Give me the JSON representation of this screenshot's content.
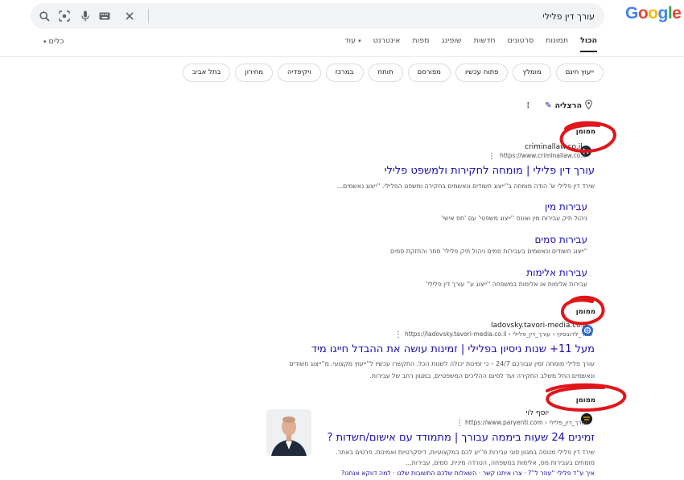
{
  "header": {
    "logo": "Google",
    "logo_colors": [
      "#4285f4",
      "#ea4335",
      "#fbbc05",
      "#4285f4",
      "#34a853",
      "#ea4335"
    ],
    "search_value": "עורך דין פלילי",
    "icons": [
      "close-icon",
      "keyboard-icon",
      "mic-icon",
      "lens-icon",
      "search-icon"
    ]
  },
  "tabs": {
    "items": [
      "הכול",
      "תמונות",
      "סרטונים",
      "חדשות",
      "שופינג",
      "מפות",
      "אינטרנט",
      "עוד"
    ],
    "active": "הכול",
    "tools_label": "כלים"
  },
  "chips": [
    "ייעוץ חינם",
    "מומלץ",
    "פתוח עכשיו",
    "מפורסם",
    "תותח",
    "במרכז",
    "ויקיפדיה",
    "מחירון",
    "בתל אביב"
  ],
  "location": {
    "label": "הרצליה"
  },
  "results": [
    {
      "sponsored": "ממומן",
      "site_name": "criminallaw.co.il",
      "url": "https://www.criminallaw.co.il",
      "title": "עורך דין פלילי | מומחה לחקירות ולמשפט פלילי",
      "description": "שירד דין פלילי ש' הודה מומחה ב''ייצוג חשודים ונאשמים בחקירה ומשפט הפלילי. ''ייצוג נאשמים...",
      "sitelinks": [
        {
          "title": "עבירות מין",
          "desc": "ניהול תיק עבירות מין ואונס ''ייצוג משפטי' עם 'חס אישי'"
        },
        {
          "title": "עבירות סמים",
          "desc": "''ייצוג חשודים ונאשמים בעבירות סמים ניהול תיק פלילי' סחר והחזקת סמים"
        },
        {
          "title": "עבירות אלימות",
          "desc": "עבירות אלימות או אלימות במשפחה ''ייצוג ע'' עורך דין פלילי'"
        }
      ]
    },
    {
      "sponsored": "ממומן",
      "site_name": "ladovsky.tavori-media.co.il",
      "url": "https://ladovsky.tavori-media.co.il › שחר_לדובסקי › עורך_דין_פלילי",
      "title": "מעל 11+ שנות ניסיון בפלילי | זמינות עושה את ההבדל חייגו מיד",
      "description_1": "עורך פלילי מומחה זמין עבורכם 24/7 – כי זמינות יכולה לשנות הכל. התקשרו עכשיו ל''ייעוץ מקצועי. מ''ייצוג חשודים",
      "description_2": "ונאשמים החל משלב החקירה ועד לסיום ההליכים המשפטיים, במגוון רחב של עבירות."
    },
    {
      "sponsored": "ממומן",
      "site_name": "יוסף לוי",
      "url": "https://www.paryenti.com › עורך_דין_פלילי",
      "title": "זמינים 24 שעות ביממה עבורך | מתמודד עם אישום/חשדות ?",
      "description_1": "שירד דין פלילי מנוסה במגוון סוגי עבירות ס''יע לכם במקצועיות, דיסקרטיות ואמינות. פרטים באתר.",
      "description_2": "מומחים בעבירות מס, אלימות במשפחה, הטרדה מינית, סמים, עבירות...",
      "inline_links": [
        "איך ע''ד פלילי ''עוזר ל''?",
        "צרו איתנו קשר",
        "השאלות שלכם התשובות שלנו",
        "למה דווקא אנחנו?"
      ]
    }
  ],
  "annotation_color": "#e0161b"
}
